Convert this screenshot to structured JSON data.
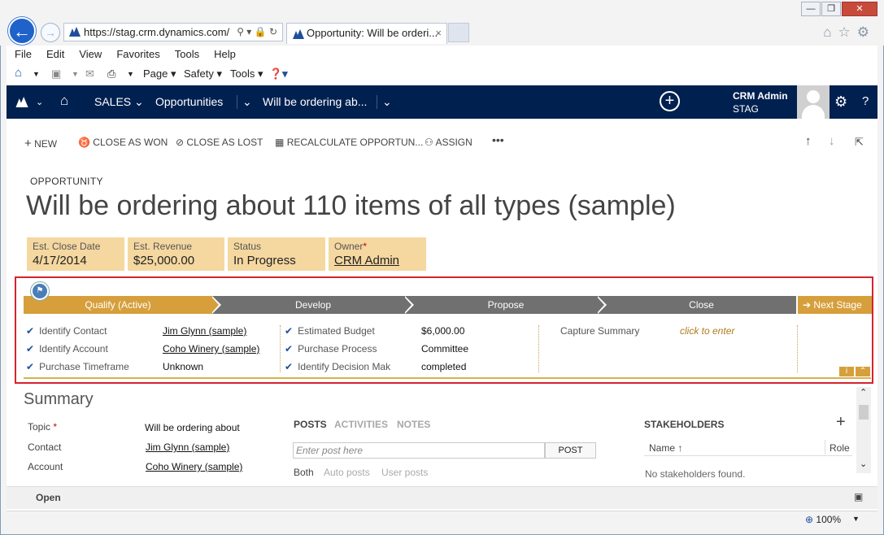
{
  "browser": {
    "url": "https://stag.crm.dynamics.com/",
    "tab_title": "Opportunity: Will be orderi...",
    "tab_close": "×",
    "minimize": "▭",
    "restore": "▭",
    "close": "✕"
  },
  "menu": [
    "File",
    "Edit",
    "View",
    "Favorites",
    "Tools",
    "Help"
  ],
  "commandbar": {
    "page": "Page",
    "safety": "Safety",
    "tools": "Tools"
  },
  "nav": {
    "area": "SALES",
    "entity": "Opportunities",
    "record": "Will be ordering ab...",
    "user_name": "CRM Admin",
    "org": "STAG"
  },
  "commands": {
    "new": "NEW",
    "close_won": "CLOSE AS WON",
    "close_lost": "CLOSE AS LOST",
    "recalc": "RECALCULATE OPPORTUN...",
    "assign": "ASSIGN",
    "more": "•••"
  },
  "record": {
    "entity_label": "OPPORTUNITY",
    "title": "Will be ordering about 110 items of all types (sample)"
  },
  "header_fields": [
    {
      "label": "Est. Close Date",
      "value": "4/17/2014"
    },
    {
      "label": "Est. Revenue",
      "value": "$25,000.00"
    },
    {
      "label": "Status",
      "value": "In Progress"
    },
    {
      "label": "Owner",
      "value": "CRM Admin",
      "required": "*"
    }
  ],
  "process": {
    "stages": [
      "Qualify (Active)",
      "Develop",
      "Propose",
      "Close"
    ],
    "next_stage": "Next Stage",
    "col1": [
      {
        "label": "Identify Contact",
        "value": "Jim Glynn (sample)"
      },
      {
        "label": "Identify Account",
        "value": "Coho Winery (sample)"
      },
      {
        "label": "Purchase Timeframe",
        "value": "Unknown"
      }
    ],
    "col2": [
      {
        "label": "Estimated Budget",
        "value": "$6,000.00"
      },
      {
        "label": "Purchase Process",
        "value": "Committee"
      },
      {
        "label": "Identify Decision Mak",
        "value": "completed"
      }
    ],
    "col3": {
      "label": "Capture Summary",
      "value": "click to enter"
    }
  },
  "summary": {
    "title": "Summary",
    "topic_label": "Topic",
    "topic_required": "*",
    "topic_value": "Will be ordering about",
    "contact_label": "Contact",
    "contact_value": "Jim Glynn (sample)",
    "account_label": "Account",
    "account_value": "Coho Winery (sample)",
    "tabs": [
      "POSTS",
      "ACTIVITIES",
      "NOTES"
    ],
    "post_placeholder": "Enter post here",
    "post_button": "POST",
    "filters": [
      "Both",
      "Auto posts",
      "User posts"
    ],
    "stakeholders_title": "STAKEHOLDERS",
    "col_name": "Name ↑",
    "col_role": "Role",
    "empty": "No stakeholders found."
  },
  "footer": {
    "status": "Open",
    "zoom": "100%"
  }
}
